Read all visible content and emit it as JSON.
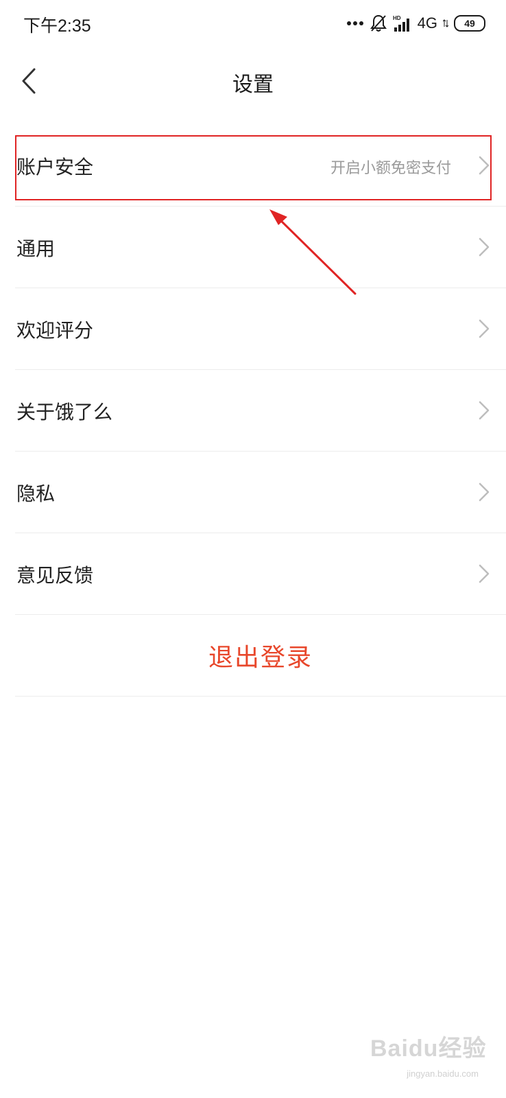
{
  "status_bar": {
    "time": "下午2:35",
    "network": "4G",
    "battery": "49",
    "icons": [
      "more-dots-icon",
      "bell-muted-icon",
      "signal-icon",
      "battery-icon"
    ]
  },
  "nav": {
    "title": "设置",
    "back_icon": "chevron-left-icon"
  },
  "settings": {
    "items": [
      {
        "label": "账户安全",
        "value": "开启小额免密支付"
      },
      {
        "label": "通用",
        "value": ""
      },
      {
        "label": "欢迎评分",
        "value": ""
      },
      {
        "label": "关于饿了么",
        "value": ""
      },
      {
        "label": "隐私",
        "value": ""
      },
      {
        "label": "意见反馈",
        "value": ""
      }
    ],
    "logout_label": "退出登录"
  },
  "annotation": {
    "highlight_color": "#e02424"
  },
  "watermark": {
    "brand": "Baidu经验",
    "url": "jingyan.baidu.com"
  },
  "colors": {
    "accent": "#e8472b",
    "text": "#222222",
    "subtext": "#9a9a9a",
    "divider": "#ececec"
  }
}
